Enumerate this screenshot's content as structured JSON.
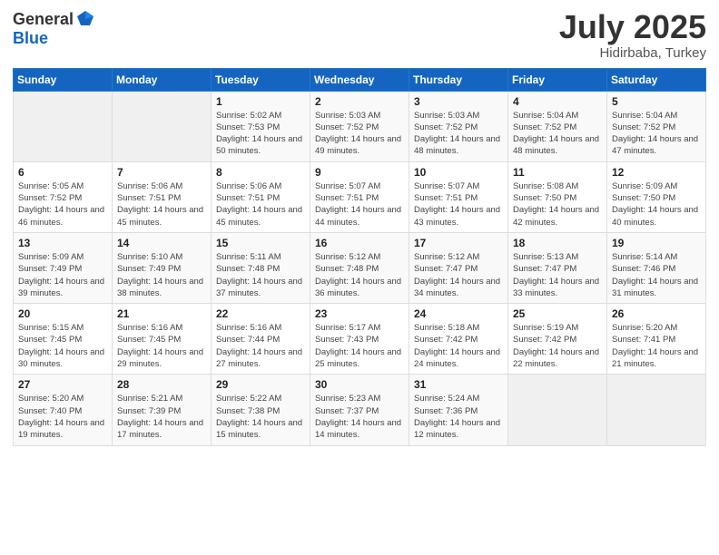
{
  "logo": {
    "general": "General",
    "blue": "Blue"
  },
  "title": "July 2025",
  "subtitle": "Hidirbaba, Turkey",
  "days_header": [
    "Sunday",
    "Monday",
    "Tuesday",
    "Wednesday",
    "Thursday",
    "Friday",
    "Saturday"
  ],
  "weeks": [
    [
      {
        "day": "",
        "sunrise": "",
        "sunset": "",
        "daylight": ""
      },
      {
        "day": "",
        "sunrise": "",
        "sunset": "",
        "daylight": ""
      },
      {
        "day": "1",
        "sunrise": "Sunrise: 5:02 AM",
        "sunset": "Sunset: 7:53 PM",
        "daylight": "Daylight: 14 hours and 50 minutes."
      },
      {
        "day": "2",
        "sunrise": "Sunrise: 5:03 AM",
        "sunset": "Sunset: 7:52 PM",
        "daylight": "Daylight: 14 hours and 49 minutes."
      },
      {
        "day": "3",
        "sunrise": "Sunrise: 5:03 AM",
        "sunset": "Sunset: 7:52 PM",
        "daylight": "Daylight: 14 hours and 48 minutes."
      },
      {
        "day": "4",
        "sunrise": "Sunrise: 5:04 AM",
        "sunset": "Sunset: 7:52 PM",
        "daylight": "Daylight: 14 hours and 48 minutes."
      },
      {
        "day": "5",
        "sunrise": "Sunrise: 5:04 AM",
        "sunset": "Sunset: 7:52 PM",
        "daylight": "Daylight: 14 hours and 47 minutes."
      }
    ],
    [
      {
        "day": "6",
        "sunrise": "Sunrise: 5:05 AM",
        "sunset": "Sunset: 7:52 PM",
        "daylight": "Daylight: 14 hours and 46 minutes."
      },
      {
        "day": "7",
        "sunrise": "Sunrise: 5:06 AM",
        "sunset": "Sunset: 7:51 PM",
        "daylight": "Daylight: 14 hours and 45 minutes."
      },
      {
        "day": "8",
        "sunrise": "Sunrise: 5:06 AM",
        "sunset": "Sunset: 7:51 PM",
        "daylight": "Daylight: 14 hours and 45 minutes."
      },
      {
        "day": "9",
        "sunrise": "Sunrise: 5:07 AM",
        "sunset": "Sunset: 7:51 PM",
        "daylight": "Daylight: 14 hours and 44 minutes."
      },
      {
        "day": "10",
        "sunrise": "Sunrise: 5:07 AM",
        "sunset": "Sunset: 7:51 PM",
        "daylight": "Daylight: 14 hours and 43 minutes."
      },
      {
        "day": "11",
        "sunrise": "Sunrise: 5:08 AM",
        "sunset": "Sunset: 7:50 PM",
        "daylight": "Daylight: 14 hours and 42 minutes."
      },
      {
        "day": "12",
        "sunrise": "Sunrise: 5:09 AM",
        "sunset": "Sunset: 7:50 PM",
        "daylight": "Daylight: 14 hours and 40 minutes."
      }
    ],
    [
      {
        "day": "13",
        "sunrise": "Sunrise: 5:09 AM",
        "sunset": "Sunset: 7:49 PM",
        "daylight": "Daylight: 14 hours and 39 minutes."
      },
      {
        "day": "14",
        "sunrise": "Sunrise: 5:10 AM",
        "sunset": "Sunset: 7:49 PM",
        "daylight": "Daylight: 14 hours and 38 minutes."
      },
      {
        "day": "15",
        "sunrise": "Sunrise: 5:11 AM",
        "sunset": "Sunset: 7:48 PM",
        "daylight": "Daylight: 14 hours and 37 minutes."
      },
      {
        "day": "16",
        "sunrise": "Sunrise: 5:12 AM",
        "sunset": "Sunset: 7:48 PM",
        "daylight": "Daylight: 14 hours and 36 minutes."
      },
      {
        "day": "17",
        "sunrise": "Sunrise: 5:12 AM",
        "sunset": "Sunset: 7:47 PM",
        "daylight": "Daylight: 14 hours and 34 minutes."
      },
      {
        "day": "18",
        "sunrise": "Sunrise: 5:13 AM",
        "sunset": "Sunset: 7:47 PM",
        "daylight": "Daylight: 14 hours and 33 minutes."
      },
      {
        "day": "19",
        "sunrise": "Sunrise: 5:14 AM",
        "sunset": "Sunset: 7:46 PM",
        "daylight": "Daylight: 14 hours and 31 minutes."
      }
    ],
    [
      {
        "day": "20",
        "sunrise": "Sunrise: 5:15 AM",
        "sunset": "Sunset: 7:45 PM",
        "daylight": "Daylight: 14 hours and 30 minutes."
      },
      {
        "day": "21",
        "sunrise": "Sunrise: 5:16 AM",
        "sunset": "Sunset: 7:45 PM",
        "daylight": "Daylight: 14 hours and 29 minutes."
      },
      {
        "day": "22",
        "sunrise": "Sunrise: 5:16 AM",
        "sunset": "Sunset: 7:44 PM",
        "daylight": "Daylight: 14 hours and 27 minutes."
      },
      {
        "day": "23",
        "sunrise": "Sunrise: 5:17 AM",
        "sunset": "Sunset: 7:43 PM",
        "daylight": "Daylight: 14 hours and 25 minutes."
      },
      {
        "day": "24",
        "sunrise": "Sunrise: 5:18 AM",
        "sunset": "Sunset: 7:42 PM",
        "daylight": "Daylight: 14 hours and 24 minutes."
      },
      {
        "day": "25",
        "sunrise": "Sunrise: 5:19 AM",
        "sunset": "Sunset: 7:42 PM",
        "daylight": "Daylight: 14 hours and 22 minutes."
      },
      {
        "day": "26",
        "sunrise": "Sunrise: 5:20 AM",
        "sunset": "Sunset: 7:41 PM",
        "daylight": "Daylight: 14 hours and 21 minutes."
      }
    ],
    [
      {
        "day": "27",
        "sunrise": "Sunrise: 5:20 AM",
        "sunset": "Sunset: 7:40 PM",
        "daylight": "Daylight: 14 hours and 19 minutes."
      },
      {
        "day": "28",
        "sunrise": "Sunrise: 5:21 AM",
        "sunset": "Sunset: 7:39 PM",
        "daylight": "Daylight: 14 hours and 17 minutes."
      },
      {
        "day": "29",
        "sunrise": "Sunrise: 5:22 AM",
        "sunset": "Sunset: 7:38 PM",
        "daylight": "Daylight: 14 hours and 15 minutes."
      },
      {
        "day": "30",
        "sunrise": "Sunrise: 5:23 AM",
        "sunset": "Sunset: 7:37 PM",
        "daylight": "Daylight: 14 hours and 14 minutes."
      },
      {
        "day": "31",
        "sunrise": "Sunrise: 5:24 AM",
        "sunset": "Sunset: 7:36 PM",
        "daylight": "Daylight: 14 hours and 12 minutes."
      },
      {
        "day": "",
        "sunrise": "",
        "sunset": "",
        "daylight": ""
      },
      {
        "day": "",
        "sunrise": "",
        "sunset": "",
        "daylight": ""
      }
    ]
  ]
}
